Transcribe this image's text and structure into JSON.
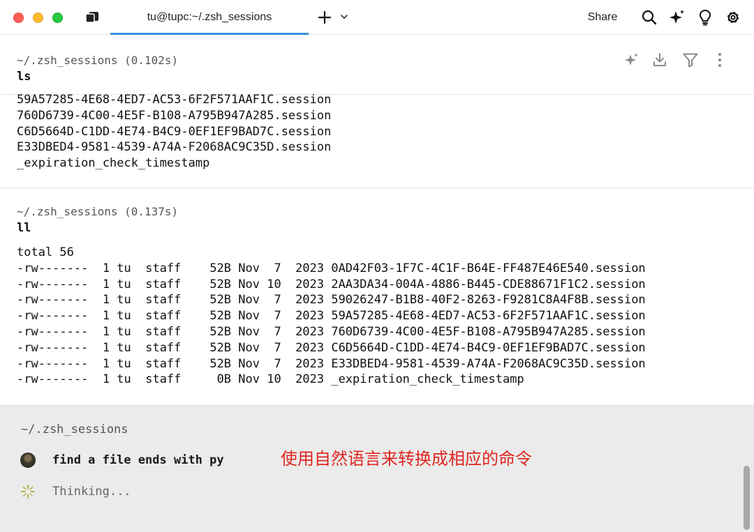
{
  "window": {
    "tab_title": "tu@tupc:~/.zsh_sessions",
    "share_label": "Share",
    "icons": [
      "panel-icon",
      "plus-icon",
      "chevron-down-icon",
      "search-icon",
      "sparkle-icon",
      "lightbulb-icon",
      "gear-icon"
    ]
  },
  "blocks": [
    {
      "path": "~/.zsh_sessions (0.102s)",
      "command": "ls",
      "output": [
        "59A57285-4E68-4ED7-AC53-6F2F571AAF1C.session",
        "760D6739-4C00-4E5F-B108-A795B947A285.session",
        "C6D5664D-C1DD-4E74-B4C9-0EF1EF9BAD7C.session",
        "E33DBED4-9581-4539-A74A-F2068AC9C35D.session",
        "_expiration_check_timestamp"
      ],
      "actions": [
        "sparkle-icon",
        "download-icon",
        "filter-icon",
        "more-icon"
      ]
    },
    {
      "path": "~/.zsh_sessions (0.137s)",
      "command": "ll",
      "output": [
        "total 56",
        "-rw-------  1 tu  staff    52B Nov  7  2023 0AD42F03-1F7C-4C1F-B64E-FF487E46E540.session",
        "-rw-------  1 tu  staff    52B Nov 10  2023 2AA3DA34-004A-4886-B445-CDE88671F1C2.session",
        "-rw-------  1 tu  staff    52B Nov  7  2023 59026247-B1B8-40F2-8263-F9281C8A4F8B.session",
        "-rw-------  1 tu  staff    52B Nov  7  2023 59A57285-4E68-4ED7-AC53-6F2F571AAF1C.session",
        "-rw-------  1 tu  staff    52B Nov  7  2023 760D6739-4C00-4E5F-B108-A795B947A285.session",
        "-rw-------  1 tu  staff    52B Nov  7  2023 C6D5664D-C1DD-4E74-B4C9-0EF1EF9BAD7C.session",
        "-rw-------  1 tu  staff    52B Nov  7  2023 E33DBED4-9581-4539-A74A-F2068AC9C35D.session",
        "-rw-------  1 tu  staff     0B Nov 10  2023 _expiration_check_timestamp"
      ]
    }
  ],
  "input": {
    "path": "~/.zsh_sessions",
    "query": "find a file ends with py",
    "status": "Thinking...",
    "annotation": "使用自然语言来转换成相应的命令"
  },
  "colors": {
    "accent": "#3a8de0",
    "annotation": "#e0261f",
    "input_bg": "#ebebeb"
  }
}
